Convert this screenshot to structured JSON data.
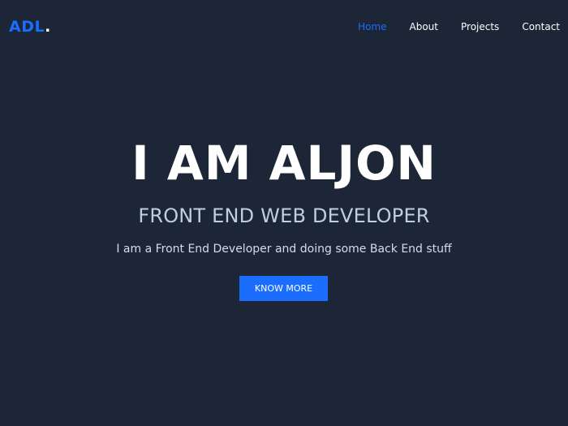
{
  "brand": {
    "logo_text": "ADL",
    "logo_dot": ".",
    "accent_color": "#1a6dfd"
  },
  "nav": {
    "items": [
      {
        "label": "Home",
        "active": true
      },
      {
        "label": "About",
        "active": false
      },
      {
        "label": "Projects",
        "active": false
      },
      {
        "label": "Contact",
        "active": false
      }
    ]
  },
  "hero": {
    "title": "I AM ALJON",
    "subtitle": "FRONT END WEB DEVELOPER",
    "description": "I am a Front End Developer and doing some Back End stuff",
    "cta_label": "KNOW MORE"
  },
  "colors": {
    "background": "#1c2637",
    "text": "#ffffff"
  }
}
